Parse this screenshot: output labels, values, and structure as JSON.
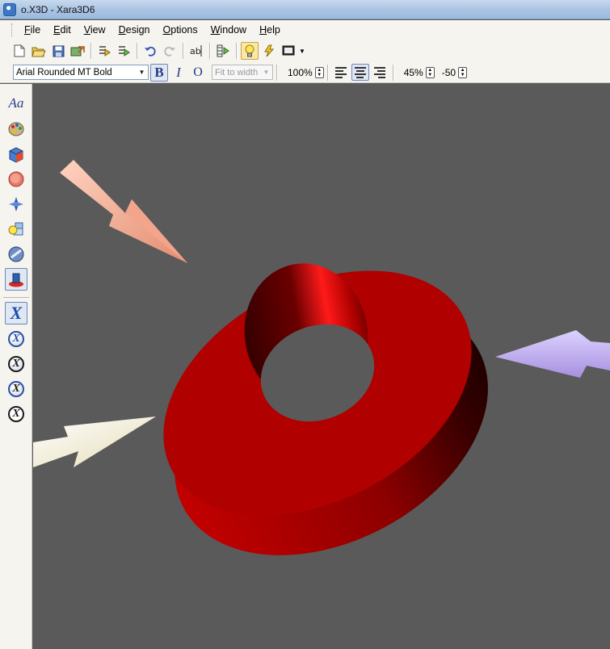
{
  "window": {
    "title": "o.X3D - Xara3D6"
  },
  "menu": [
    "File",
    "Edit",
    "View",
    "Design",
    "Options",
    "Window",
    "Help"
  ],
  "toolbar1": {
    "buttons": [
      "new-icon",
      "open-icon",
      "save-icon",
      "export-icon",
      "camera-icon",
      "camera-options-icon",
      "undo-icon",
      "redo-icon",
      "text-icon",
      "animation-icon",
      "lights-icon",
      "lightning-icon",
      "display-icon"
    ]
  },
  "toolbar2": {
    "font": "Arial Rounded MT Bold",
    "bold_label": "B",
    "italic_label": "I",
    "outline_label": "O",
    "fit_mode": "Fit to width",
    "size": "100%",
    "alignment": "center",
    "spacing": "45%",
    "line_spacing": "-50"
  },
  "left_toolbar": {
    "text_tool_label": "Aa",
    "tools": [
      "text-tool",
      "color-tool",
      "extrude-tool",
      "bevel-tool",
      "shading-tool",
      "lights-tool",
      "texture-tool",
      "shadow-tool"
    ],
    "logo_buttons": [
      "X",
      "X",
      "X",
      "X",
      "X"
    ]
  },
  "scene": {
    "text": "o",
    "text_color": "#cc0000",
    "background": "#5a5a5a",
    "lights": [
      {
        "name": "light-1",
        "color": "#f2a88e"
      },
      {
        "name": "light-2",
        "color": "#c4b4ee"
      },
      {
        "name": "light-3",
        "color": "#f6efd6"
      }
    ]
  }
}
